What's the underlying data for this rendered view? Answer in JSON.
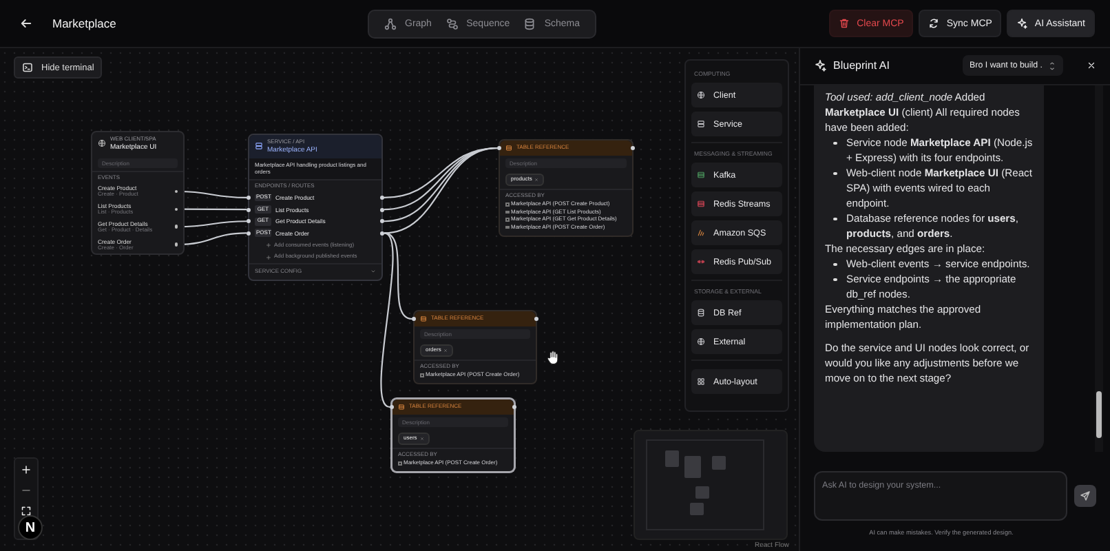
{
  "header": {
    "title": "Marketplace",
    "views": [
      {
        "label": "Graph",
        "selected": false
      },
      {
        "label": "Sequence",
        "selected": false
      },
      {
        "label": "Schema",
        "selected": false
      }
    ],
    "actions": [
      {
        "label": "Clear MCP",
        "kind": "danger"
      },
      {
        "label": "Sync MCP",
        "kind": "sync"
      },
      {
        "label": "AI Assistant",
        "kind": "ai"
      }
    ]
  },
  "canvas": {
    "terminal_button": "Hide terminal",
    "nodes": [
      {
        "kind": "client",
        "type_label": "WEB CLIENT/SPA",
        "title": "Marketplace UI",
        "placeholder": "Description",
        "section": "EVENTS",
        "events": [
          {
            "name": "Create Product",
            "detail": "Create · Product"
          },
          {
            "name": "List Products",
            "detail": "List · Products"
          },
          {
            "name": "Get Product Details",
            "detail": "Get · Product · Details"
          },
          {
            "name": "Create Order",
            "detail": "Create · Order"
          }
        ]
      },
      {
        "kind": "service",
        "type_label": "SERVICE / API",
        "title": "Marketplace API",
        "description": "Marketplace API handling product listings and orders",
        "section": "ENDPOINTS / ROUTES",
        "endpoints": [
          {
            "method": "POST",
            "name": "Create Product"
          },
          {
            "method": "GET",
            "name": "List Products"
          },
          {
            "method": "GET",
            "name": "Get Product Details"
          },
          {
            "method": "POST",
            "name": "Create Order"
          }
        ],
        "add_links": [
          "Add consumed events (listening)",
          "Add background published events"
        ],
        "config_label": "SERVICE CONFIG"
      },
      {
        "kind": "table",
        "type_label": "TABLE REFERENCE",
        "placeholder": "Description",
        "table": "products",
        "accessed_label": "ACCESSED BY",
        "selected": false,
        "accessed_by": [
          "Marketplace API (POST Create Product)",
          "Marketplace API (GET List Products)",
          "Marketplace API (GET Get Product Details)",
          "Marketplace API (POST Create Order)"
        ]
      },
      {
        "kind": "table",
        "type_label": "TABLE REFERENCE",
        "placeholder": "Description",
        "table": "orders",
        "accessed_label": "ACCESSED BY",
        "selected": false,
        "accessed_by": [
          "Marketplace API (POST Create Order)"
        ]
      },
      {
        "kind": "table",
        "type_label": "TABLE REFERENCE",
        "placeholder": "Description",
        "table": "users",
        "accessed_label": "ACCESSED BY",
        "selected": true,
        "accessed_by": [
          "Marketplace API (POST Create Order)"
        ]
      }
    ],
    "palette": {
      "sections": [
        {
          "title": "COMPUTING",
          "items": [
            {
              "label": "Client",
              "kind": "client"
            },
            {
              "label": "Service",
              "kind": "service"
            }
          ]
        },
        {
          "title": "MESSAGING & STREAMING",
          "items": [
            {
              "label": "Kafka",
              "kind": "kafka"
            },
            {
              "label": "Redis Streams",
              "kind": "redis-streams"
            },
            {
              "label": "Amazon SQS",
              "kind": "sqs"
            },
            {
              "label": "Redis Pub/Sub",
              "kind": "pubsub"
            }
          ]
        },
        {
          "title": "STORAGE & EXTERNAL",
          "items": [
            {
              "label": "DB Ref",
              "kind": "db"
            },
            {
              "label": "External",
              "kind": "external"
            }
          ]
        }
      ],
      "auto_layout": "Auto-layout"
    },
    "dev_badge": "N",
    "attribution": "React Flow"
  },
  "assistant": {
    "title": "Blueprint AI",
    "conversation": "Bro I want to build .",
    "message": [
      {
        "kind": "paragraph",
        "text": "*Tool used: add_client_node* Added **Marketplace UI** (client) All required nodes have been added:"
      },
      {
        "kind": "list",
        "items": [
          "Service node **Marketplace API** (Node.js + Express) with its four endpoints.",
          "Web-client node **Marketplace UI** (React SPA) with events wired to each endpoint.",
          "Database reference nodes for **users**, **products**, and **orders**."
        ]
      },
      {
        "kind": "paragraph",
        "text": "The necessary edges are in place:"
      },
      {
        "kind": "list",
        "items": [
          "Web-client events → service endpoints.",
          "Service endpoints → the appropriate db_ref nodes."
        ]
      },
      {
        "kind": "paragraph",
        "text": "Everything matches the approved implementation plan."
      },
      {
        "kind": "question",
        "text": "Do the service and UI nodes look correct, or would you like any adjustments before we move on to the next stage?"
      }
    ],
    "placeholder": "Ask AI to design your system...",
    "disclaimer": "AI can make mistakes. Verify the generated design."
  }
}
